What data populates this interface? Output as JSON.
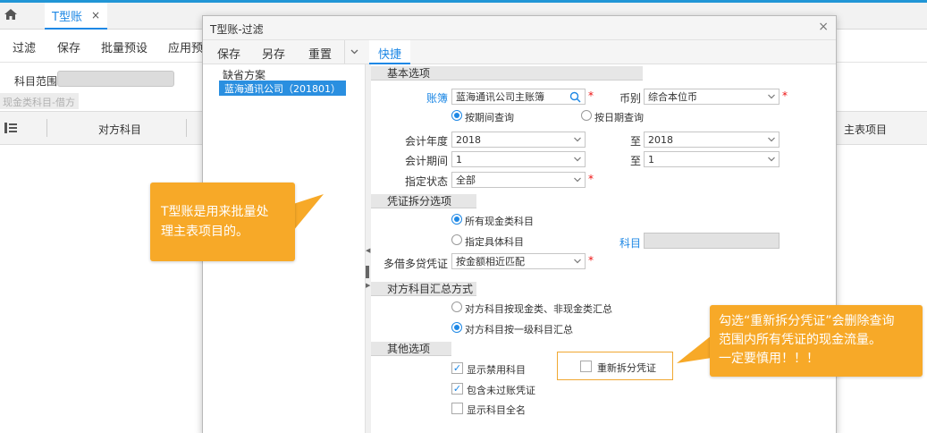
{
  "app": {
    "tab_title": "T型账",
    "tab_close": "×",
    "toolbar": {
      "filter": "过滤",
      "save": "保存",
      "batch_preset": "批量预设",
      "apply_preset": "应用预"
    },
    "subject_range_label": "科目范围",
    "cash_subject_label": "现金类科目-借方",
    "grid_columns": {
      "contra_subject": "对方科目",
      "main_item": "主表项目"
    }
  },
  "dialog": {
    "title": "T型账-过滤",
    "close": "×",
    "toolbar": {
      "save": "保存",
      "save_as": "另存",
      "reset": "重置",
      "quick_tab": "快捷"
    },
    "schemes": {
      "title": "缺省方案",
      "items": [
        "蓝海通讯公司（201801）"
      ]
    },
    "basic": {
      "section": "基本选项",
      "ledger_label": "账簿",
      "ledger_value": "蓝海通讯公司主账簿",
      "currency_label": "币别",
      "currency_value": "综合本位币",
      "by_period": "按期间查询",
      "by_date": "按日期查询",
      "fiscal_year_label": "会计年度",
      "fiscal_year_from": "2018",
      "to1": "至",
      "fiscal_year_to": "2018",
      "period_label": "会计期间",
      "period_from": "1",
      "to2": "至",
      "period_to": "1",
      "status_label": "指定状态",
      "status_value": "全部",
      "required_mark": "*"
    },
    "split": {
      "section": "凭证拆分选项",
      "all_cash": "所有现金类科目",
      "specific": "指定具体科目",
      "subject_label": "科目",
      "multi_label": "多借多贷凭证",
      "multi_value": "按金额相近匹配"
    },
    "summary": {
      "section": "对方科目汇总方式",
      "by_cash": "对方科目按现金类、非现金类汇总",
      "by_level1": "对方科目按一级科目汇总"
    },
    "other": {
      "section": "其他选项",
      "show_disabled": "显示禁用科目",
      "include_unposted": "包含未过账凭证",
      "show_fullname": "显示科目全名",
      "resplit": "重新拆分凭证",
      "check_mark": "✓"
    }
  },
  "callouts": {
    "left": [
      "T型账是用来批量处",
      "理主表项目的。"
    ],
    "right": [
      "勾选“重新拆分凭证”会删除查询",
      "范围内所有凭证的现金流量。",
      "一定要慎用！！！"
    ]
  },
  "colors": {
    "accent": "#1e88e5",
    "callout": "#f7a928",
    "required": "#e11111"
  }
}
